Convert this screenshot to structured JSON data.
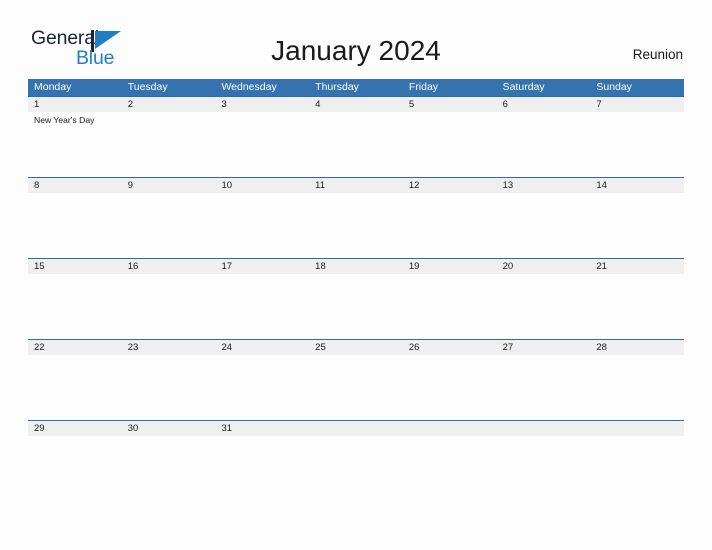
{
  "brand": {
    "name_part1": "General",
    "name_part2": "Blue",
    "flag_icon": "flag-triangle-icon",
    "color_dark": "#19243a",
    "color_blue": "#1f7fc4"
  },
  "header": {
    "title": "January 2024",
    "region": "Reunion"
  },
  "colors": {
    "header_bar": "#3573b0",
    "week_rule": "#2a6ca8",
    "date_band": "#efefef",
    "page_background": "#fdfdfd",
    "text": "#1a1a1a"
  },
  "calendar": {
    "weekdays": [
      "Monday",
      "Tuesday",
      "Wednesday",
      "Thursday",
      "Friday",
      "Saturday",
      "Sunday"
    ],
    "weeks": [
      {
        "days": [
          {
            "date": "1",
            "events": [
              "New Year's Day"
            ]
          },
          {
            "date": "2",
            "events": []
          },
          {
            "date": "3",
            "events": []
          },
          {
            "date": "4",
            "events": []
          },
          {
            "date": "5",
            "events": []
          },
          {
            "date": "6",
            "events": []
          },
          {
            "date": "7",
            "events": []
          }
        ]
      },
      {
        "days": [
          {
            "date": "8",
            "events": []
          },
          {
            "date": "9",
            "events": []
          },
          {
            "date": "10",
            "events": []
          },
          {
            "date": "11",
            "events": []
          },
          {
            "date": "12",
            "events": []
          },
          {
            "date": "13",
            "events": []
          },
          {
            "date": "14",
            "events": []
          }
        ]
      },
      {
        "days": [
          {
            "date": "15",
            "events": []
          },
          {
            "date": "16",
            "events": []
          },
          {
            "date": "17",
            "events": []
          },
          {
            "date": "18",
            "events": []
          },
          {
            "date": "19",
            "events": []
          },
          {
            "date": "20",
            "events": []
          },
          {
            "date": "21",
            "events": []
          }
        ]
      },
      {
        "days": [
          {
            "date": "22",
            "events": []
          },
          {
            "date": "23",
            "events": []
          },
          {
            "date": "24",
            "events": []
          },
          {
            "date": "25",
            "events": []
          },
          {
            "date": "26",
            "events": []
          },
          {
            "date": "27",
            "events": []
          },
          {
            "date": "28",
            "events": []
          }
        ]
      },
      {
        "days": [
          {
            "date": "29",
            "events": []
          },
          {
            "date": "30",
            "events": []
          },
          {
            "date": "31",
            "events": []
          },
          {
            "date": "",
            "events": []
          },
          {
            "date": "",
            "events": []
          },
          {
            "date": "",
            "events": []
          },
          {
            "date": "",
            "events": []
          }
        ]
      }
    ]
  }
}
